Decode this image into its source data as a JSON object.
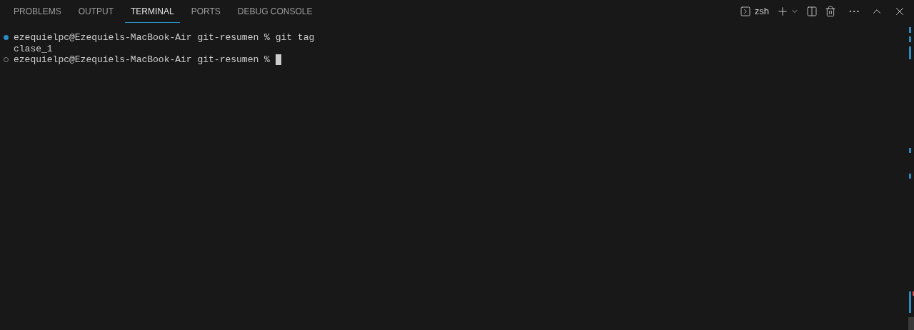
{
  "tabs": [
    {
      "label": "PROBLEMS",
      "selected": false
    },
    {
      "label": "OUTPUT",
      "selected": false
    },
    {
      "label": "TERMINAL",
      "selected": true
    },
    {
      "label": "PORTS",
      "selected": false
    },
    {
      "label": "DEBUG CONSOLE",
      "selected": false
    }
  ],
  "terminal_selector": {
    "label": "zsh"
  },
  "terminal": {
    "lines": [
      {
        "kind": "command-success",
        "text": "ezequielpc@Ezequiels-MacBook-Air git-resumen % git tag"
      },
      {
        "kind": "output",
        "text": "clase_1"
      },
      {
        "kind": "prompt",
        "text": "ezequielpc@Ezequiels-MacBook-Air git-resumen % ",
        "cursor": true
      }
    ]
  }
}
